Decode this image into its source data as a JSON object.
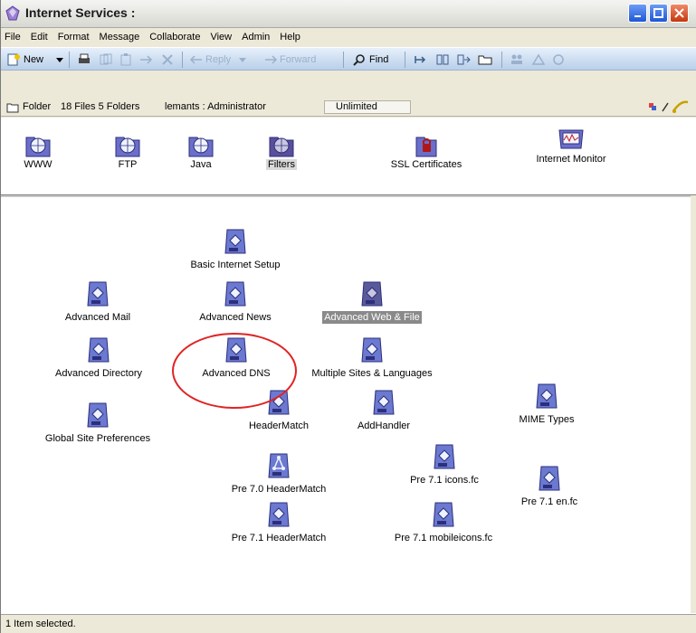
{
  "window": {
    "title": "Internet Services :"
  },
  "menu": [
    {
      "label": "File"
    },
    {
      "label": "Edit"
    },
    {
      "label": "Format"
    },
    {
      "label": "Message"
    },
    {
      "label": "Collaborate"
    },
    {
      "label": "View"
    },
    {
      "label": "Admin"
    },
    {
      "label": "Help"
    }
  ],
  "toolbar": {
    "new_label": "New",
    "reply_label": "Reply",
    "forward_label": "Forward",
    "find_label": "Find"
  },
  "infobar": {
    "folder_label": "Folder",
    "counts": "18 Files 5 Folders",
    "user": "lemants : Administrator",
    "quota": "Unlimited"
  },
  "shelf": [
    {
      "label": "WWW"
    },
    {
      "label": "FTP"
    },
    {
      "label": "Java"
    },
    {
      "label": "Filters"
    },
    {
      "label": "SSL Certificates"
    },
    {
      "label": "Internet Monitor"
    }
  ],
  "nodes": {
    "basic_internet_setup": "Basic Internet Setup",
    "advanced_mail": "Advanced Mail",
    "advanced_news": "Advanced News",
    "advanced_web_file": "Advanced Web & File",
    "advanced_directory": "Advanced Directory",
    "advanced_dns": "Advanced DNS",
    "multiple_sites": "Multiple Sites & Languages",
    "global_site_preferences": "Global Site Preferences",
    "headermatch": "HeaderMatch",
    "addhandler": "AddHandler",
    "mime_types": "MIME Types",
    "pre70_headermatch": "Pre 7.0 HeaderMatch",
    "pre71_icons": "Pre 7.1 icons.fc",
    "pre71_en": "Pre 7.1 en.fc",
    "pre71_headermatch": "Pre 7.1 HeaderMatch",
    "pre71_mobileicons": "Pre 7.1 mobileicons.fc"
  },
  "status": {
    "text": "1 Item selected."
  },
  "colors": {
    "selection": "#8a8a8a",
    "highlight_ring": "#e02424",
    "title_close": "#c5380f"
  }
}
